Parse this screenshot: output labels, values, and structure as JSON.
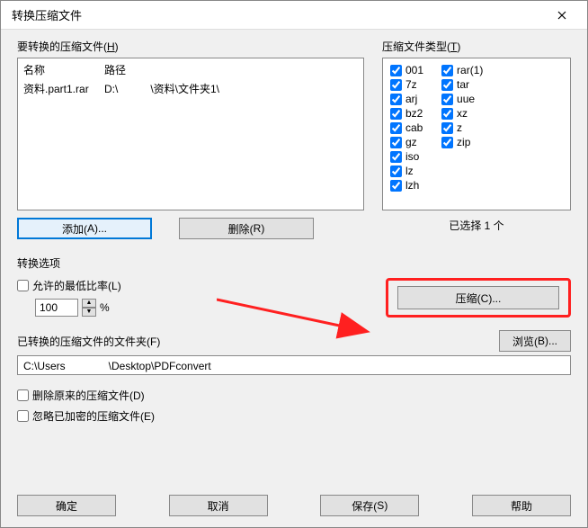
{
  "title": "转换压缩文件",
  "filesLabelPre": "要转换的压缩文件(",
  "filesLabelKey": "H",
  "filesLabelPost": ")",
  "colName": "名称",
  "colPath": "路径",
  "fileRow": {
    "name": "资料.part1.rar",
    "path": "D:\\　　　\\资料\\文件夹1\\"
  },
  "typesLabelPre": "压缩文件类型(",
  "typesLabelKey": "T",
  "typesLabelPost": ")",
  "types1": [
    "001",
    "7z",
    "arj",
    "bz2",
    "cab",
    "gz",
    "iso",
    "lz",
    "lzh"
  ],
  "types2": [
    "rar(1)",
    "tar",
    "uue",
    "xz",
    "z",
    "zip"
  ],
  "addBtnPre": "添加(",
  "addBtnKey": "A",
  "addBtnPost": ")...",
  "delBtnPre": "删除(",
  "delBtnKey": "R",
  "delBtnPost": ")",
  "selectedText": "已选择 1 个",
  "optionsLabel": "转换选项",
  "allowMinPre": "允许的最低比率(",
  "allowMinKey": "L",
  "allowMinPost": ")",
  "ratioValue": "100",
  "pct": "%",
  "compressPre": "压缩(",
  "compressKey": "C",
  "compressPost": ")...",
  "folderLabelPre": "已转换的压缩文件的文件夹(",
  "folderLabelKey": "F",
  "folderLabelPost": ")",
  "browsePre": "浏览(",
  "browseKey": "B",
  "browsePost": ")...",
  "folderPath": "C:\\Users　　　　\\Desktop\\PDFconvert",
  "delOrigPre": "删除原来的压缩文件(",
  "delOrigKey": "D",
  "delOrigPost": ")",
  "ignoreEncPre": "忽略已加密的压缩文件(",
  "ignoreEncKey": "E",
  "ignoreEncPost": ")",
  "okBtn": "确定",
  "cancelBtn": "取消",
  "savePre": "保存(",
  "saveKey": "S",
  "savePost": ")",
  "helpBtn": "帮助"
}
